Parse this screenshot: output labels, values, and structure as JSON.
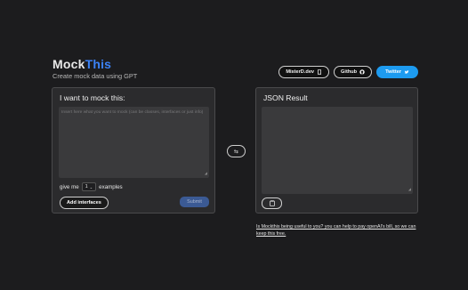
{
  "brand": {
    "title_main": "Mock",
    "title_accent": "This",
    "subtitle": "Create mock data using GPT"
  },
  "nav": {
    "misterd": "MisterD.dev",
    "github": "Github",
    "twitter": "Twitter"
  },
  "left_panel": {
    "heading": "I want to mock this:",
    "placeholder": "Insert here what you want to mock (can be classes, interfaces or just info)",
    "give_me": "give me",
    "examples_count": "1",
    "examples_label": "examples",
    "add_interfaces": "Add interfaces",
    "submit": "Submit"
  },
  "right_panel": {
    "heading": "JSON Result"
  },
  "footer": {
    "text": "Is Mockthis being useful to you? you can help to pay openAI's bill, so we can keep this free."
  },
  "colors": {
    "accent": "#3b82f6",
    "twitter": "#1d9bf0",
    "submit": "#3b5a94",
    "background": "#1c1c1e"
  },
  "icons": {
    "misterd": "mobile-icon",
    "github": "github-icon",
    "twitter": "twitter-bird-icon",
    "swap": "swap-icon",
    "copy": "clipboard-icon"
  }
}
